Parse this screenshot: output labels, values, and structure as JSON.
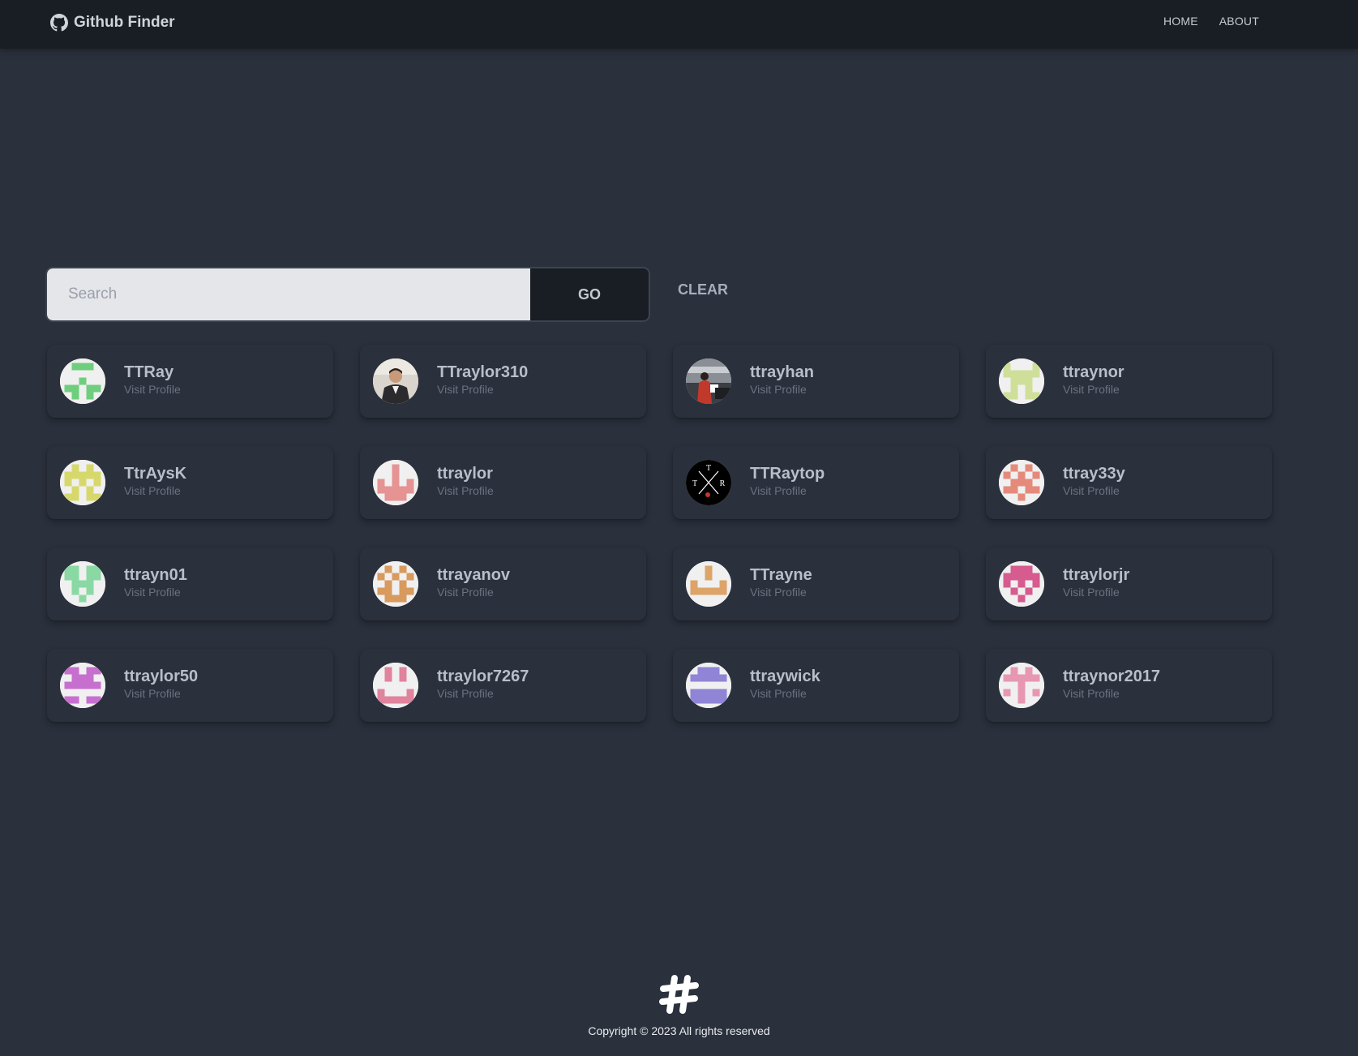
{
  "header": {
    "brand": "Github Finder",
    "nav": [
      {
        "label": "HOME"
      },
      {
        "label": "ABOUT"
      }
    ]
  },
  "search": {
    "placeholder": "Search",
    "value": "",
    "go_label": "GO",
    "clear_label": "CLEAR"
  },
  "users": [
    {
      "login": "TTRay",
      "link_label": "Visit Profile",
      "avatar": "identicon",
      "color": "#6fce7e"
    },
    {
      "login": "TTraylor310",
      "link_label": "Visit Profile",
      "avatar": "photo-man-suit",
      "color": "#3a3a3a"
    },
    {
      "login": "ttrayhan",
      "link_label": "Visit Profile",
      "avatar": "photo-red-jacket",
      "color": "#c0392b"
    },
    {
      "login": "ttraynor",
      "link_label": "Visit Profile",
      "avatar": "identicon",
      "color": "#cfdf9a"
    },
    {
      "login": "TtrAysK",
      "link_label": "Visit Profile",
      "avatar": "identicon",
      "color": "#d7d86c"
    },
    {
      "login": "ttraylor",
      "link_label": "Visit Profile",
      "avatar": "identicon",
      "color": "#e59393"
    },
    {
      "login": "TTRaytop",
      "link_label": "Visit Profile",
      "avatar": "logo-txr",
      "color": "#000000"
    },
    {
      "login": "ttray33y",
      "link_label": "Visit Profile",
      "avatar": "identicon",
      "color": "#e58a7b"
    },
    {
      "login": "ttrayn01",
      "link_label": "Visit Profile",
      "avatar": "identicon",
      "color": "#8ad9a4"
    },
    {
      "login": "ttrayanov",
      "link_label": "Visit Profile",
      "avatar": "identicon",
      "color": "#d99a5e"
    },
    {
      "login": "TTrayne",
      "link_label": "Visit Profile",
      "avatar": "identicon",
      "color": "#dca468"
    },
    {
      "login": "ttraylorjr",
      "link_label": "Visit Profile",
      "avatar": "identicon",
      "color": "#d65b8e"
    },
    {
      "login": "ttraylor50",
      "link_label": "Visit Profile",
      "avatar": "identicon",
      "color": "#c76fcf"
    },
    {
      "login": "ttraylor7267",
      "link_label": "Visit Profile",
      "avatar": "identicon",
      "color": "#e0839d"
    },
    {
      "login": "ttraywick",
      "link_label": "Visit Profile",
      "avatar": "identicon",
      "color": "#8f84d6"
    },
    {
      "login": "ttraynor2017",
      "link_label": "Visit Profile",
      "avatar": "identicon",
      "color": "#e897b3"
    }
  ],
  "footer": {
    "copyright": "Copyright © 2023 All rights reserved",
    "logo_icon": "hash-logo-icon"
  },
  "colors": {
    "background": "#2a303c",
    "navbar": "#191e24",
    "input": "#e5e6ea"
  }
}
